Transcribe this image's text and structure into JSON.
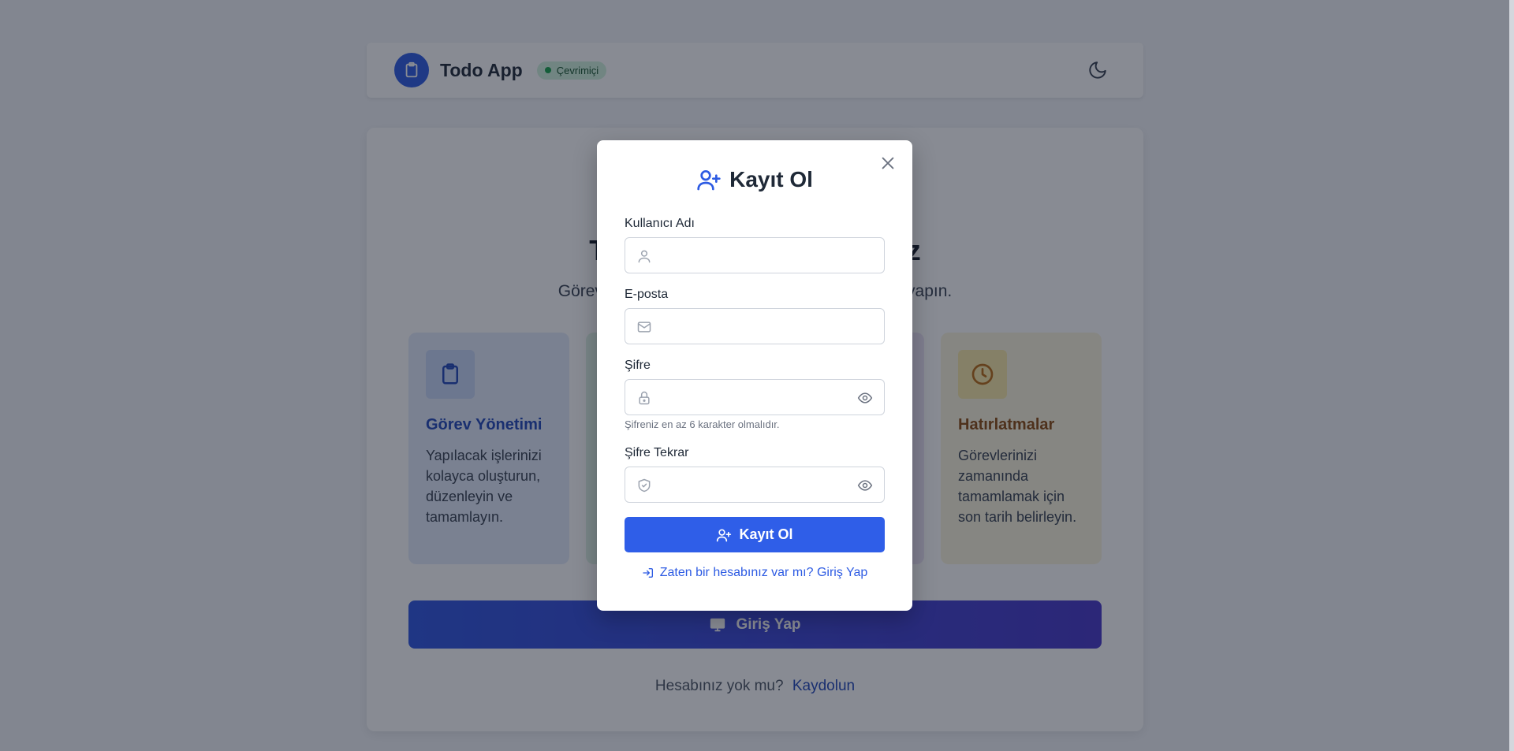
{
  "navbar": {
    "title": "Todo App",
    "status": "Çevrimiçi",
    "brand_icon": "clipboard-icon",
    "theme_icon": "moon-icon"
  },
  "hero": {
    "title": "Todo App'e Hoş Geldiniz",
    "subtitle": "Görevlerinizi yönetmek ve takip etmek için giriş yapın."
  },
  "features": [
    {
      "icon": "clipboard-icon",
      "title": "Görev Yönetimi",
      "description": "Yapılacak işlerinizi kolayca oluşturun, düzenleyin ve tamamlayın."
    },
    {
      "icon": "clock-icon",
      "title": "Hatırlatmalar",
      "description": "Görevlerinizi zamanında tamamlamak için son tarih belirleyin."
    }
  ],
  "login_button": {
    "label": "Giriş Yap",
    "icon": "monitor-icon"
  },
  "signup_prompt": {
    "text": "Hesabınız yok mu?",
    "link": "Kaydolun"
  },
  "modal": {
    "title": "Kayıt Ol",
    "icon": "user-plus-icon",
    "fields": {
      "username": {
        "label": "Kullanıcı Adı",
        "value": "",
        "icon": "user-icon"
      },
      "email": {
        "label": "E-posta",
        "value": "",
        "icon": "mail-icon"
      },
      "password": {
        "label": "Şifre",
        "value": "",
        "icon": "lock-icon",
        "hint": "Şifreniz en az 6 karakter olmalıdır."
      },
      "password_repeat": {
        "label": "Şifre Tekrar",
        "value": "",
        "icon": "shield-icon"
      }
    },
    "submit_label": "Kayıt Ol",
    "switch_link": "Zaten bir hesabınız var mı? Giriş Yap"
  },
  "colors": {
    "primary": "#2f5ee8",
    "overlay": "rgba(17,24,39,0.5)",
    "status_green": "#16a34a"
  }
}
